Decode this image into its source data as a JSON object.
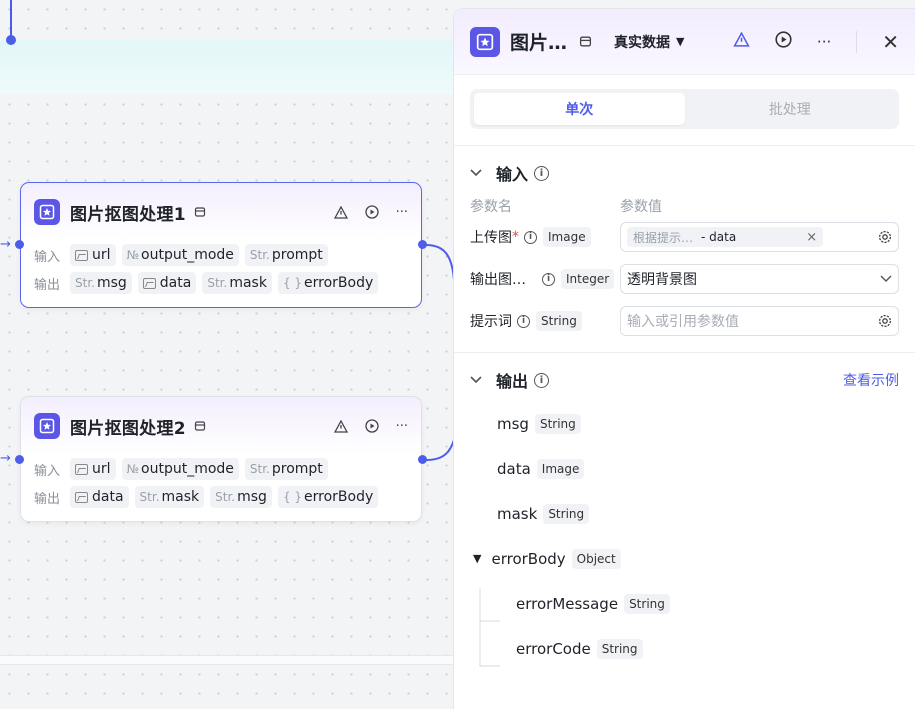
{
  "canvas": {
    "nodes": [
      {
        "title": "图片抠图处理1",
        "input_label": "输入",
        "output_label": "输出",
        "inputs": [
          {
            "prefix": "img",
            "name": "url"
          },
          {
            "prefix": "№",
            "name": "output_mode"
          },
          {
            "prefix": "Str.",
            "name": "prompt"
          }
        ],
        "outputs": [
          {
            "prefix": "Str.",
            "name": "msg"
          },
          {
            "prefix": "img",
            "name": "data"
          },
          {
            "prefix": "Str.",
            "name": "mask"
          },
          {
            "prefix": "{ }",
            "name": "errorBody"
          }
        ]
      },
      {
        "title": "图片抠图处理2",
        "input_label": "输入",
        "output_label": "输出",
        "inputs": [
          {
            "prefix": "img",
            "name": "url"
          },
          {
            "prefix": "№",
            "name": "output_mode"
          },
          {
            "prefix": "Str.",
            "name": "prompt"
          }
        ],
        "outputs": [
          {
            "prefix": "img",
            "name": "data"
          },
          {
            "prefix": "Str.",
            "name": "mask"
          },
          {
            "prefix": "Str.",
            "name": "msg"
          },
          {
            "prefix": "{ }",
            "name": "errorBody"
          }
        ]
      }
    ]
  },
  "panel": {
    "title": "图片…",
    "mode_label": "真实数据",
    "tabs": {
      "single": "单次",
      "batch": "批处理"
    },
    "input": {
      "section_title": "输入",
      "col_name": "参数名",
      "col_value": "参数值",
      "params": [
        {
          "name": "上传图",
          "required_mark": "*",
          "type": "Image",
          "ref_source": "根据提示…",
          "ref_value": "- data",
          "clear": "×"
        },
        {
          "name": "输出图…",
          "type": "Integer",
          "value": "透明背景图"
        },
        {
          "name": "提示词",
          "type": "String",
          "placeholder": "输入或引用参数值"
        }
      ]
    },
    "output": {
      "section_title": "输出",
      "example_link": "查看示例",
      "fields": [
        {
          "name": "msg",
          "type": "String"
        },
        {
          "name": "data",
          "type": "Image"
        },
        {
          "name": "mask",
          "type": "String"
        },
        {
          "name": "errorBody",
          "type": "Object"
        },
        {
          "name": "errorMessage",
          "type": "String"
        },
        {
          "name": "errorCode",
          "type": "String"
        }
      ]
    }
  },
  "colors": {
    "accent": "#4e5de8",
    "node_icon_bg": "#5b56e6",
    "required": "#e5484d"
  }
}
